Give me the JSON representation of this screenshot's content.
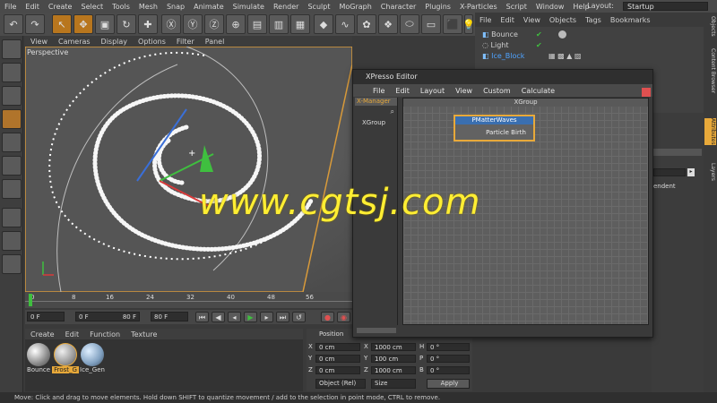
{
  "menubar": {
    "items": [
      "File",
      "Edit",
      "Create",
      "Select",
      "Tools",
      "Mesh",
      "Snap",
      "Animate",
      "Simulate",
      "Render",
      "Sculpt",
      "MoGraph",
      "Character",
      "Plugins",
      "X-Particles",
      "Script",
      "Window",
      "Help"
    ],
    "layout_label": "Layout:",
    "layout_value": "Startup"
  },
  "viewport": {
    "menu": [
      "View",
      "Cameras",
      "Display",
      "Options",
      "Filter",
      "Panel"
    ],
    "label": "Perspective"
  },
  "timeline": {
    "ticks": [
      "0",
      "8",
      "16",
      "24",
      "32",
      "40",
      "48",
      "56"
    ],
    "frame_current": "0 F",
    "frame_start": "0 F",
    "frame_end": "80 F",
    "frame_max": "80 F"
  },
  "materials": {
    "menu": [
      "Create",
      "Edit",
      "Function",
      "Texture"
    ],
    "items": [
      "Bounce",
      "Frost_G",
      "Ice_Gen"
    ]
  },
  "coordinates": {
    "header": "Position",
    "rows": [
      {
        "axis": "X",
        "pos": "0 cm",
        "size_axis": "X",
        "size": "1000 cm",
        "rot_axis": "H",
        "rot": "0 °"
      },
      {
        "axis": "Y",
        "pos": "0 cm",
        "size_axis": "Y",
        "size": "100 cm",
        "rot_axis": "P",
        "rot": "0 °"
      },
      {
        "axis": "Z",
        "pos": "0 cm",
        "size_axis": "Z",
        "size": "1000 cm",
        "rot_axis": "B",
        "rot": "0 °"
      }
    ],
    "mode": "Object (Rel)",
    "size_mode": "Size",
    "apply": "Apply"
  },
  "object_manager": {
    "menu": [
      "File",
      "Edit",
      "View",
      "Objects",
      "Tags",
      "Bookmarks"
    ],
    "objects": [
      "Bounce",
      "Light",
      "Ice_Block"
    ]
  },
  "side_tabs": [
    "Objects",
    "Content Browser",
    "Attributes",
    "Layers"
  ],
  "attributes": {
    "partial_text": "endent"
  },
  "xpresso": {
    "title": "XPresso Editor",
    "menu": [
      "File",
      "Edit",
      "Layout",
      "View",
      "Custom",
      "Calculate"
    ],
    "xmanager_label": "X-Manager",
    "xmanager_item": "XGroup",
    "group_title": "XGroup",
    "node_title": "PMatterWaves",
    "node_port": "Particle Birth"
  },
  "watermark": "www.cgtsj.com",
  "statusbar": "Move: Click and drag to move elements. Hold down SHIFT to quantize movement / add to the selection in point mode, CTRL to remove.",
  "colors": {
    "accent": "#e8a93a",
    "node_header": "#3a6fb0",
    "watermark": "#ffee33"
  }
}
